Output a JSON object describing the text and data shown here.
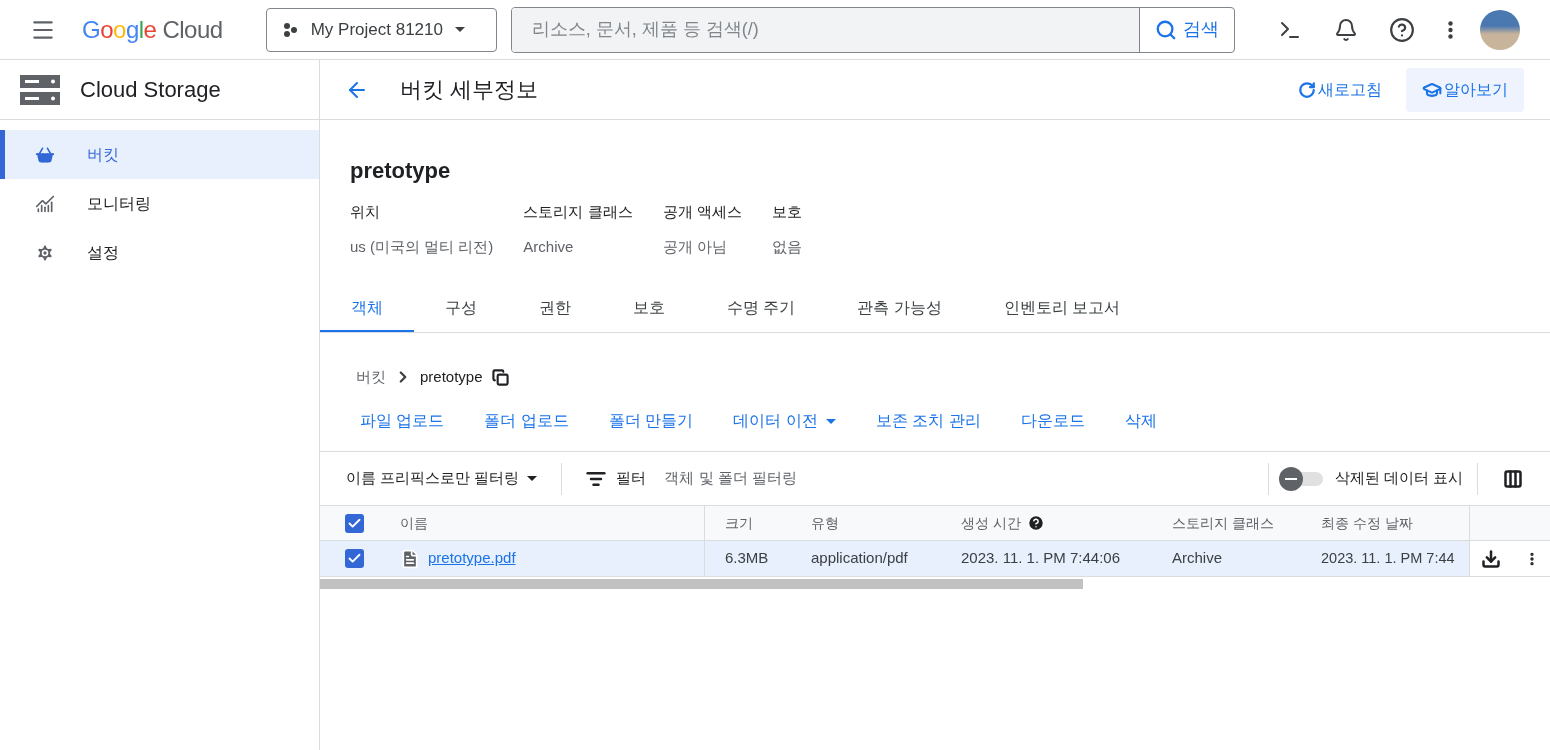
{
  "header": {
    "brand": "Google",
    "product": "Cloud",
    "project": "My Project 81210",
    "search": {
      "placeholder": "리소스, 문서, 제품 등 검색(/)",
      "button": "검색"
    }
  },
  "sidebar": {
    "title": "Cloud Storage",
    "items": [
      {
        "label": "버킷",
        "kind": "bucket",
        "selected": true
      },
      {
        "label": "모니터링",
        "kind": "chart",
        "selected": false
      },
      {
        "label": "설정",
        "kind": "gear",
        "selected": false
      }
    ]
  },
  "page": {
    "title": "버킷 세부정보",
    "refresh": "새로고침",
    "learn": "알아보기"
  },
  "bucket": {
    "name": "pretotype",
    "properties": [
      {
        "label": "위치",
        "value": "us (미국의 멀티 리전)"
      },
      {
        "label": "스토리지 클래스",
        "value": "Archive"
      },
      {
        "label": "공개 액세스",
        "value": "공개 아님"
      },
      {
        "label": "보호",
        "value": "없음"
      }
    ]
  },
  "tabs": [
    {
      "label": "객체",
      "selected": true
    },
    {
      "label": "구성",
      "selected": false
    },
    {
      "label": "권한",
      "selected": false
    },
    {
      "label": "보호",
      "selected": false
    },
    {
      "label": "수명 주기",
      "selected": false
    },
    {
      "label": "관측 가능성",
      "selected": false
    },
    {
      "label": "인벤토리 보고서",
      "selected": false
    }
  ],
  "breadcrumb": {
    "root": "버킷",
    "current": "pretotype"
  },
  "actions": [
    {
      "label": "파일 업로드",
      "dropdown": false
    },
    {
      "label": "폴더 업로드",
      "dropdown": false
    },
    {
      "label": "폴더 만들기",
      "dropdown": false
    },
    {
      "label": "데이터 이전",
      "dropdown": true
    },
    {
      "label": "보존 조치 관리",
      "dropdown": false
    },
    {
      "label": "다운로드",
      "dropdown": false
    },
    {
      "label": "삭제",
      "dropdown": false
    }
  ],
  "filter_bar": {
    "prefix_filter": "이름 프리픽스로만 필터링",
    "filter": "필터",
    "placeholder": "객체 및 폴더 필터링",
    "show_deleted": {
      "label": "삭제된 데이터 표시",
      "on": false
    }
  },
  "table": {
    "all_checked": true,
    "columns": [
      {
        "label": "이름",
        "help": false
      },
      {
        "label": "크기",
        "help": false
      },
      {
        "label": "유형",
        "help": false
      },
      {
        "label": "생성 시간",
        "help": true
      },
      {
        "label": "스토리지 클래스",
        "help": false
      },
      {
        "label": "최종 수정 날짜",
        "help": false
      }
    ],
    "rows": [
      {
        "checked": true,
        "name": "pretotype.pdf",
        "size": "6.3MB",
        "type": "application/pdf",
        "created": "2023. 11. 1. PM 7:44:06",
        "storage_class": "Archive",
        "modified": "2023. 11. 1. PM 7:44"
      }
    ]
  }
}
